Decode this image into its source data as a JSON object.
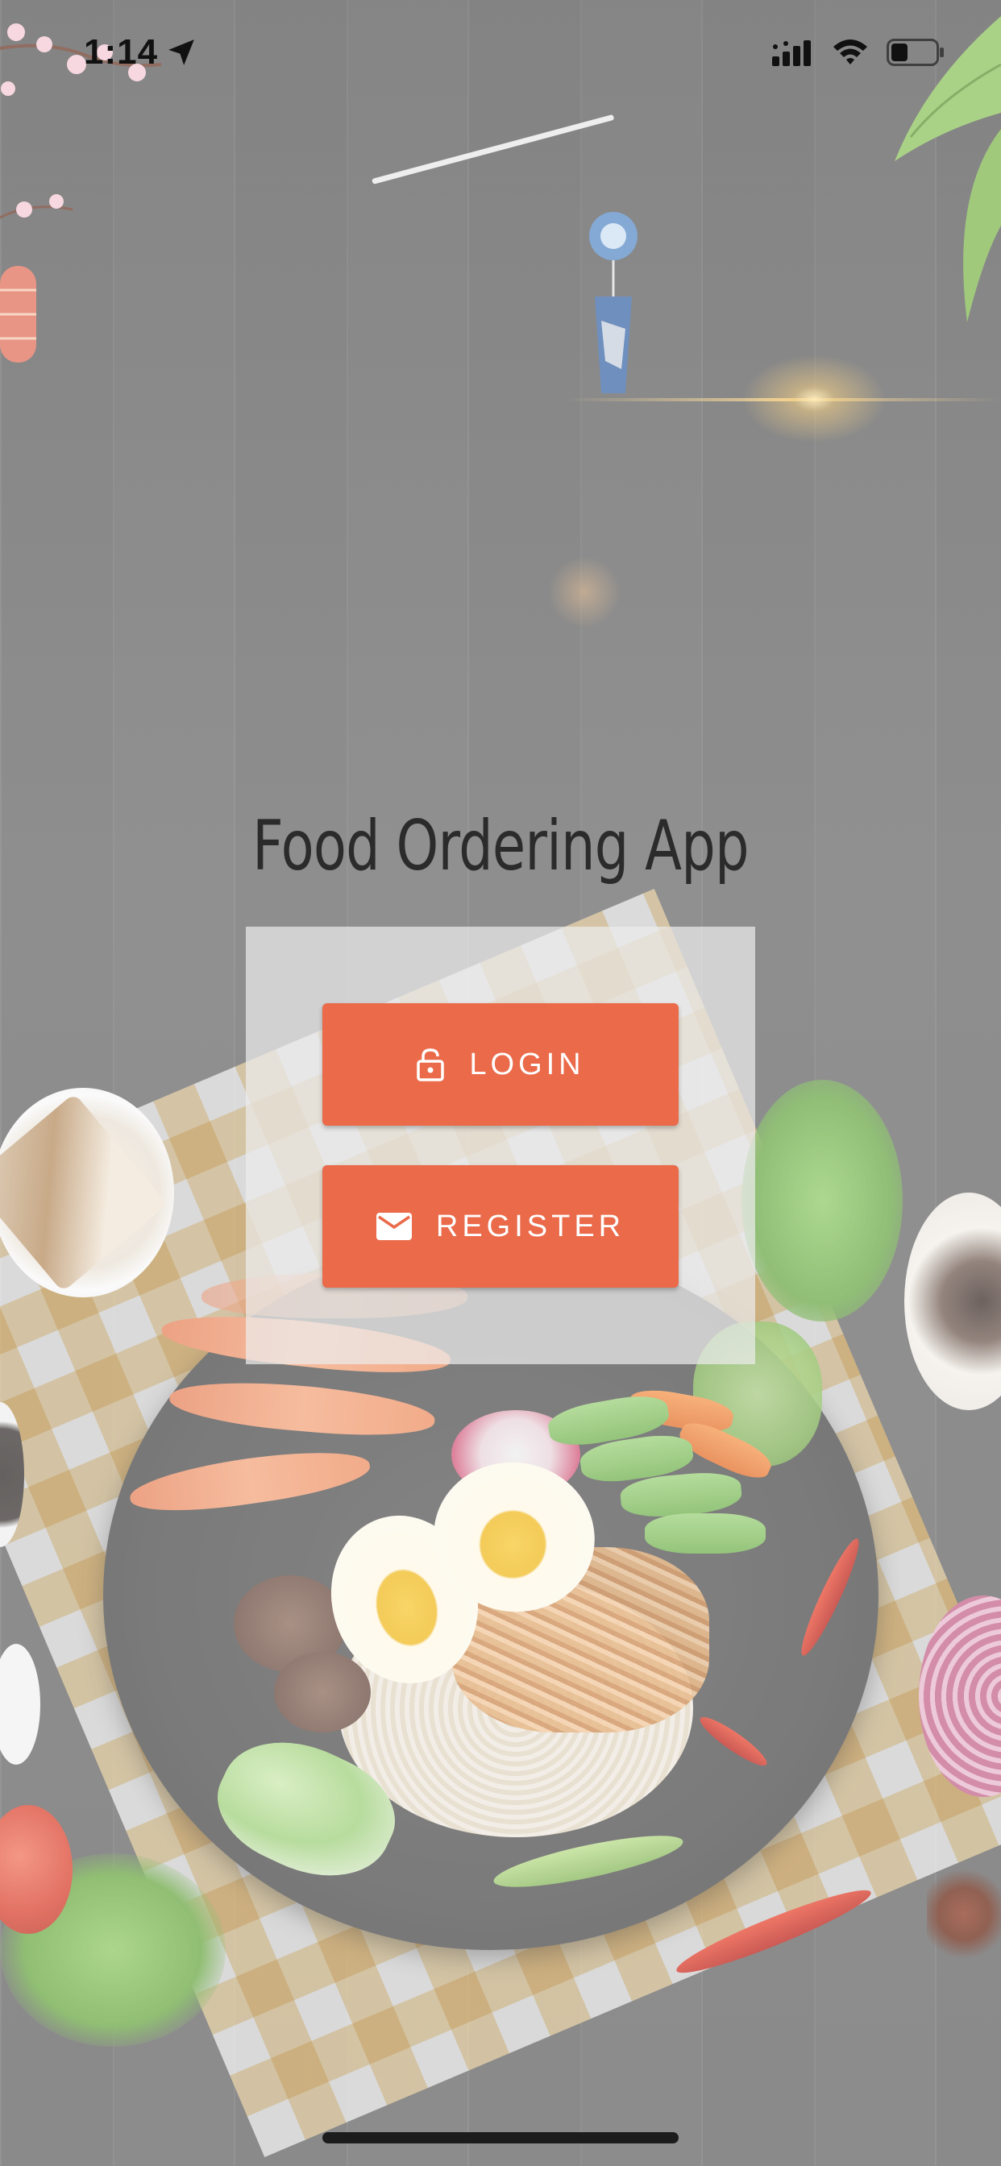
{
  "status_bar": {
    "time": "1:14",
    "icons": [
      "location-arrow-icon",
      "cellular-signal-icon",
      "wifi-icon",
      "battery-icon"
    ]
  },
  "app": {
    "title": "Food Ordering App"
  },
  "buttons": {
    "login": {
      "label": "LOGIN",
      "icon": "lock-icon"
    },
    "register": {
      "label": "REGISTER",
      "icon": "mail-icon"
    }
  },
  "colors": {
    "button_bg": "#ea6a4a",
    "button_text": "#ffffff",
    "title_text": "#2b2b2b",
    "card_bg": "#ebebeb"
  }
}
